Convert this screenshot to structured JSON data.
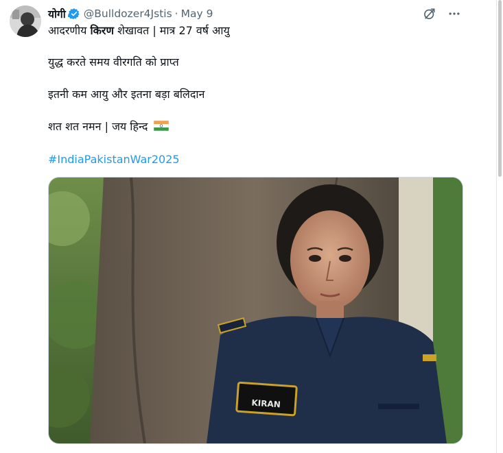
{
  "tweet": {
    "display_name": "योगी",
    "handle": "@Bulldozer4Jstis",
    "separator": "·",
    "date": "May 9",
    "line1_pre": "आदरणीय ",
    "line1_bold": "किरण",
    "line1_post": " शेखावत | मात्र 27 वर्ष आयु",
    "line2": "युद्ध करते समय वीरगति को प्राप्त",
    "line3": "इतनी कम आयु और इतना बड़ा बलिदान",
    "line4": "शत शत नमन | जय हिन्द",
    "hashtag": "#IndiaPakistanWar2025",
    "badge_text": "KIRAN"
  },
  "icons": {
    "verified": "verified-badge-icon",
    "grok": "grok-icon",
    "more": "more-options-icon",
    "flag": "india-flag-icon"
  },
  "colors": {
    "verified": "#1d9bf0",
    "hashtag": "#1d9bf0",
    "secondary_text": "#536471",
    "uniform": "#1f2f4a"
  }
}
